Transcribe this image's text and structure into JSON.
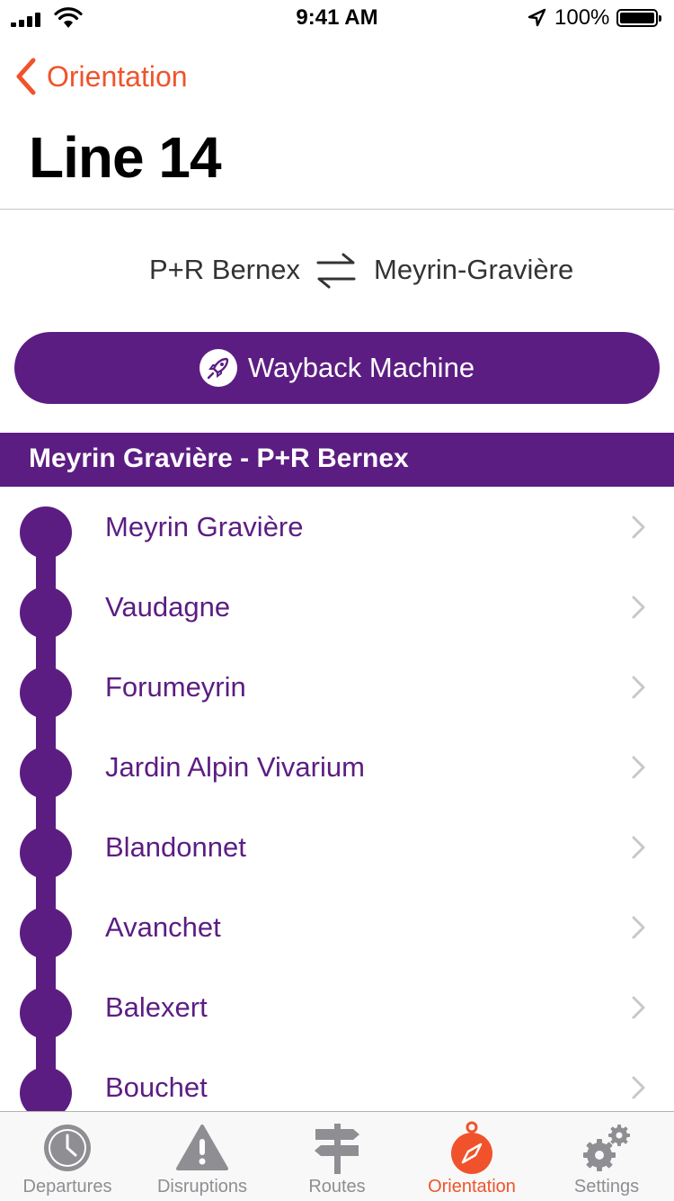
{
  "status_bar": {
    "time": "9:41 AM",
    "battery": "100%"
  },
  "nav": {
    "back_label": "Orientation"
  },
  "page": {
    "title": "Line 14"
  },
  "direction": {
    "from": "P+R Bernex",
    "to": "Meyrin-Gravière"
  },
  "wayback_button": {
    "label": "Wayback Machine"
  },
  "section": {
    "title": "Meyrin Gravière - P+R Bernex"
  },
  "stops": [
    {
      "name": "Meyrin Gravière"
    },
    {
      "name": "Vaudagne"
    },
    {
      "name": "Forumeyrin"
    },
    {
      "name": "Jardin Alpin Vivarium"
    },
    {
      "name": "Blandonnet"
    },
    {
      "name": "Avanchet"
    },
    {
      "name": "Balexert"
    },
    {
      "name": "Bouchet"
    }
  ],
  "tabs": [
    {
      "label": "Departures",
      "icon": "clock-icon"
    },
    {
      "label": "Disruptions",
      "icon": "warning-icon"
    },
    {
      "label": "Routes",
      "icon": "signpost-icon"
    },
    {
      "label": "Orientation",
      "icon": "compass-icon",
      "active": true
    },
    {
      "label": "Settings",
      "icon": "gears-icon"
    }
  ],
  "colors": {
    "accent": "#f0532b",
    "line": "#5c1d82",
    "tab_inactive": "#8e8e93"
  }
}
